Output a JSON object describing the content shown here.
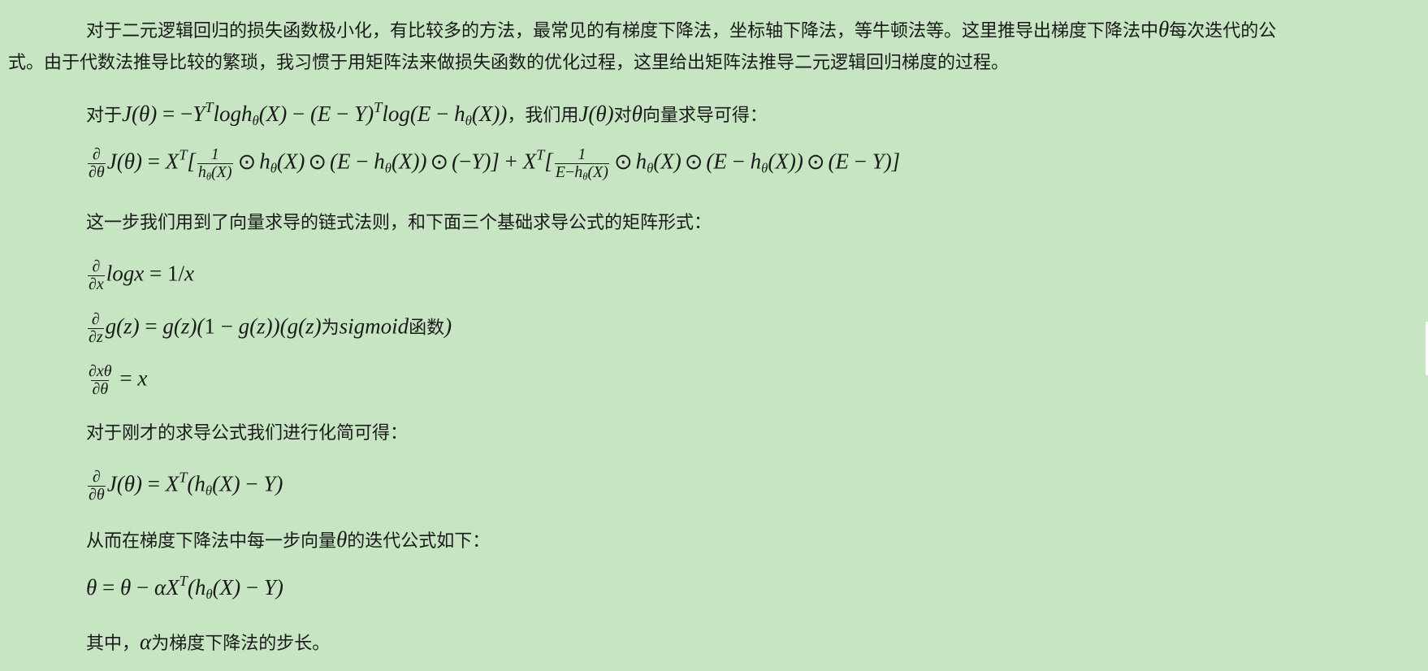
{
  "paragraph1": {
    "line1_before": "对于二元逻辑回归的损失函数极小化，有比较多的方法，最常见的有梯度下降法，坐标轴下降法，等牛顿法等。这里推导出梯度下降法中",
    "line1_sym": "θ",
    "line1_after": "每次迭代的公",
    "line2": "式。由于代数法推导比较的繁琐，我习惯于用矩阵法来做损失函数的优化过程，这里给出矩阵法推导二元逻辑回归梯度的过程。"
  },
  "intro": {
    "prefix": "对于",
    "formula": "J(θ) = −YᵀloghΘ(X) − (E − Y)ᵀlog(E − hθ(X))",
    "mid1": "，我们用",
    "mid2": "对",
    "suffix": "向量求导可得："
  },
  "chain_text": "这一步我们用到了向量求导的链式法则，和下面三个基础求导公式的矩阵形式：",
  "sigmoid_note": {
    "wei": "为",
    "name": "sigmoid",
    "hanshu": "函数"
  },
  "simplify_text": "对于刚才的求导公式我们进行化简可得：",
  "iterate_text": {
    "before": "从而在梯度下降法中每一步向量",
    "sym": "θ",
    "after": "的迭代公式如下："
  },
  "step_text": {
    "before": "其中，",
    "sym": "α",
    "after": "为梯度下降法的步长。"
  }
}
